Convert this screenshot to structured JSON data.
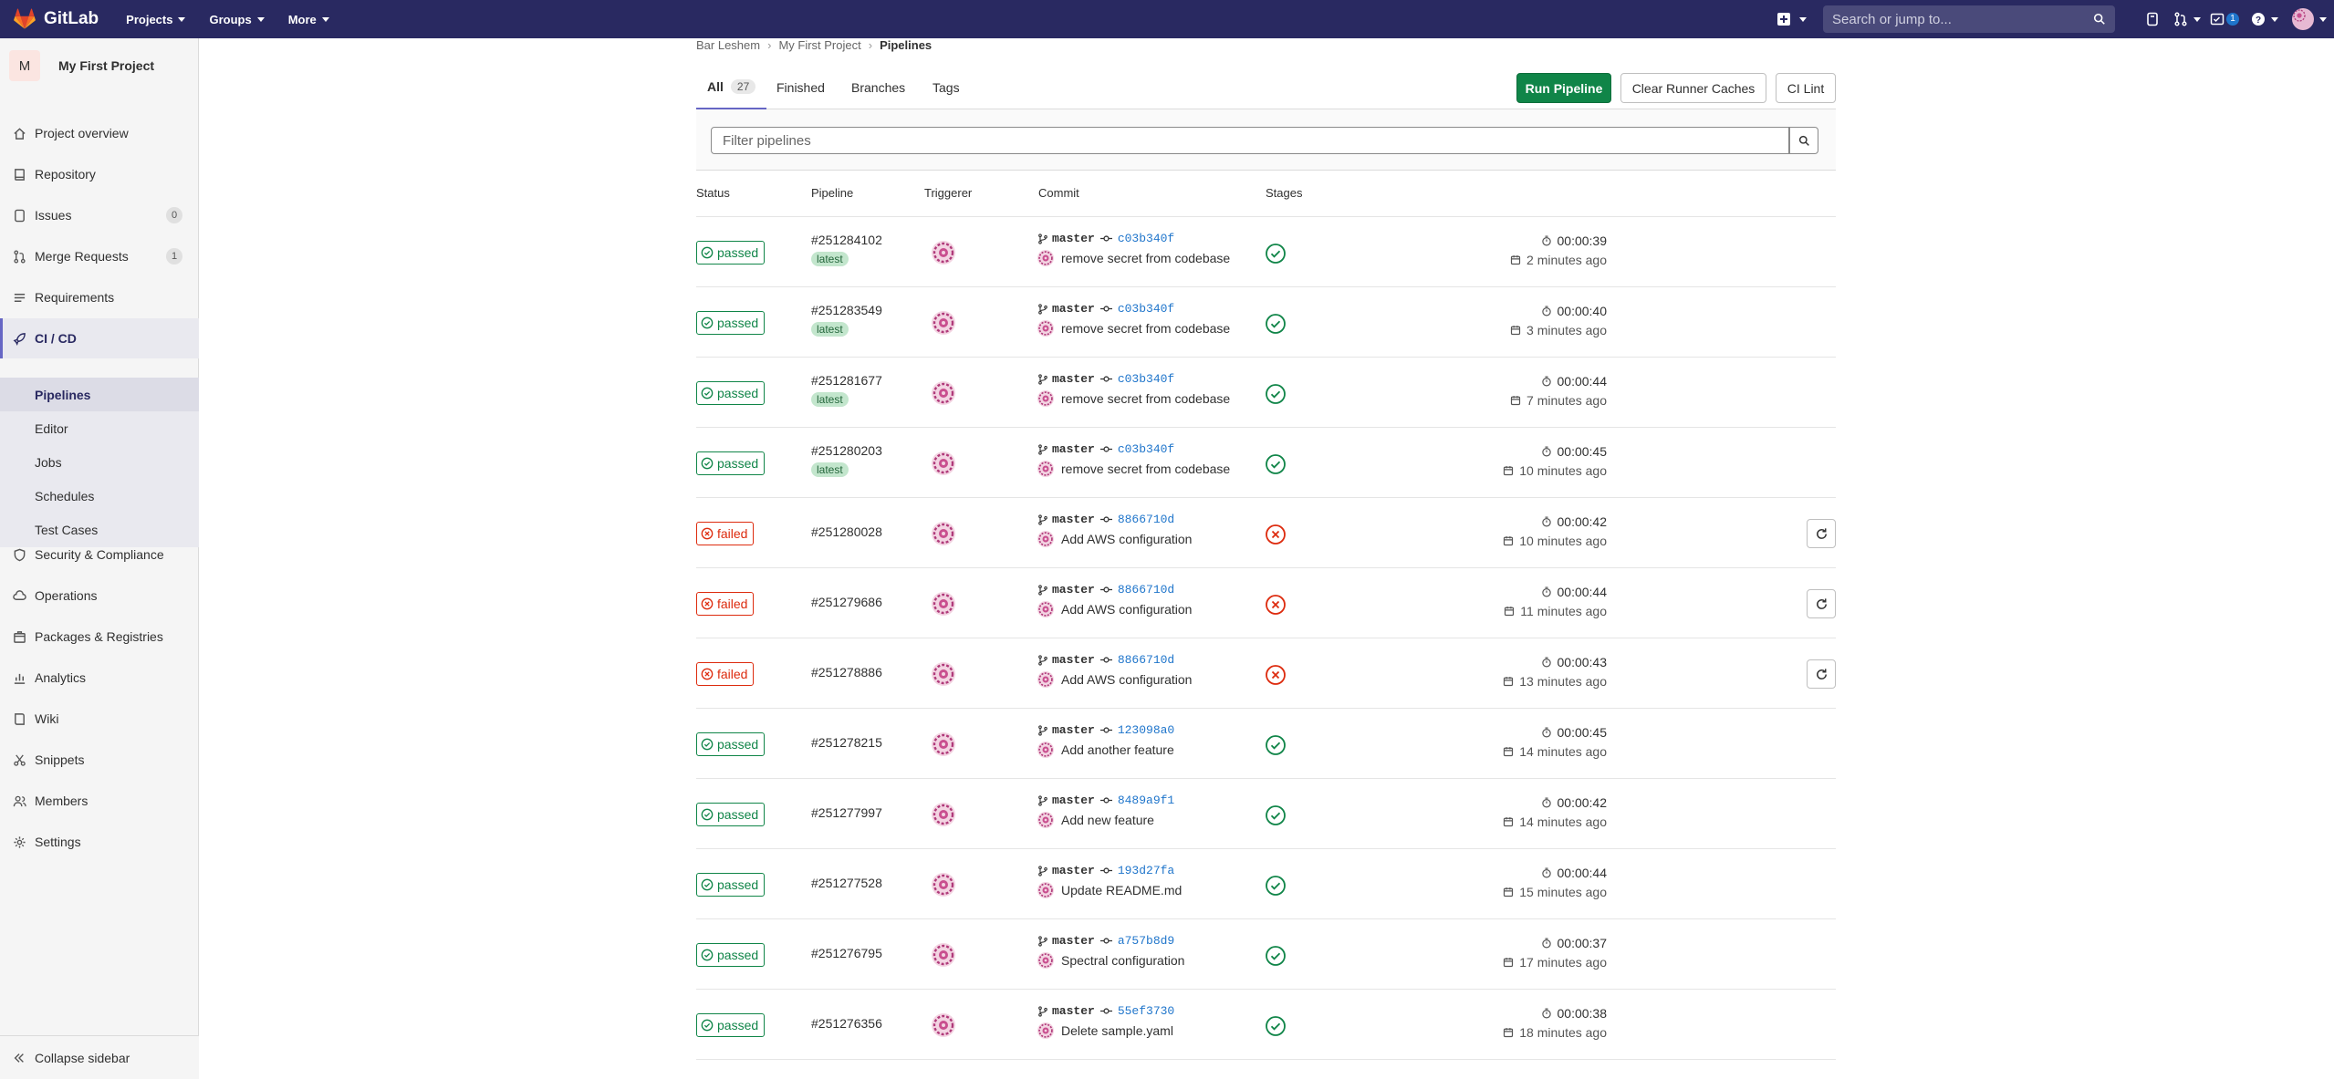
{
  "topbar": {
    "brand": "GitLab",
    "menus": [
      "Projects",
      "Groups",
      "More"
    ],
    "search_placeholder": "Search or jump to...",
    "todo_count": "1"
  },
  "sidebar": {
    "project_initial": "M",
    "project_name": "My First Project",
    "items": [
      {
        "label": "Project overview",
        "icon": "home-icon"
      },
      {
        "label": "Repository",
        "icon": "repository-icon"
      },
      {
        "label": "Issues",
        "icon": "issues-icon",
        "count": "0"
      },
      {
        "label": "Merge Requests",
        "icon": "merge-request-icon",
        "count": "1"
      },
      {
        "label": "Requirements",
        "icon": "requirements-icon"
      },
      {
        "label": "CI / CD",
        "icon": "rocket-icon"
      },
      {
        "label": "Security & Compliance",
        "icon": "shield-icon"
      },
      {
        "label": "Operations",
        "icon": "cloud-gear-icon"
      },
      {
        "label": "Packages & Registries",
        "icon": "package-icon"
      },
      {
        "label": "Analytics",
        "icon": "chart-icon"
      },
      {
        "label": "Wiki",
        "icon": "book-icon"
      },
      {
        "label": "Snippets",
        "icon": "snippet-icon"
      },
      {
        "label": "Members",
        "icon": "users-icon"
      },
      {
        "label": "Settings",
        "icon": "gear-icon"
      }
    ],
    "cicd_sub": [
      "Pipelines",
      "Editor",
      "Jobs",
      "Schedules",
      "Test Cases"
    ],
    "collapse_label": "Collapse sidebar"
  },
  "breadcrumb": [
    "Bar Leshem",
    "My First Project",
    "Pipelines"
  ],
  "tabs": [
    {
      "label": "All",
      "count": "27"
    },
    {
      "label": "Finished"
    },
    {
      "label": "Branches"
    },
    {
      "label": "Tags"
    }
  ],
  "buttons": {
    "run_pipeline": "Run Pipeline",
    "clear_caches": "Clear Runner Caches",
    "ci_lint": "CI Lint"
  },
  "filter_placeholder": "Filter pipelines",
  "columns": [
    "Status",
    "Pipeline",
    "Triggerer",
    "Commit",
    "Stages"
  ],
  "colors": {
    "navbar": "#292961",
    "passed": "#108548",
    "failed": "#dd2b0e",
    "link": "#1f75cb"
  },
  "pipelines": [
    {
      "status": "passed",
      "id": "#251284102",
      "latest": "latest",
      "branch": "master",
      "sha": "c03b340f",
      "message": "remove secret from codebase",
      "duration": "00:00:39",
      "ago": "2 minutes ago"
    },
    {
      "status": "passed",
      "id": "#251283549",
      "latest": "latest",
      "branch": "master",
      "sha": "c03b340f",
      "message": "remove secret from codebase",
      "duration": "00:00:40",
      "ago": "3 minutes ago"
    },
    {
      "status": "passed",
      "id": "#251281677",
      "latest": "latest",
      "branch": "master",
      "sha": "c03b340f",
      "message": "remove secret from codebase",
      "duration": "00:00:44",
      "ago": "7 minutes ago"
    },
    {
      "status": "passed",
      "id": "#251280203",
      "latest": "latest",
      "branch": "master",
      "sha": "c03b340f",
      "message": "remove secret from codebase",
      "duration": "00:00:45",
      "ago": "10 minutes ago"
    },
    {
      "status": "failed",
      "id": "#251280028",
      "branch": "master",
      "sha": "8866710d",
      "message": "Add AWS configuration",
      "duration": "00:00:42",
      "ago": "10 minutes ago"
    },
    {
      "status": "failed",
      "id": "#251279686",
      "branch": "master",
      "sha": "8866710d",
      "message": "Add AWS configuration",
      "duration": "00:00:44",
      "ago": "11 minutes ago"
    },
    {
      "status": "failed",
      "id": "#251278886",
      "branch": "master",
      "sha": "8866710d",
      "message": "Add AWS configuration",
      "duration": "00:00:43",
      "ago": "13 minutes ago"
    },
    {
      "status": "passed",
      "id": "#251278215",
      "branch": "master",
      "sha": "123098a0",
      "message": "Add another feature",
      "duration": "00:00:45",
      "ago": "14 minutes ago"
    },
    {
      "status": "passed",
      "id": "#251277997",
      "branch": "master",
      "sha": "8489a9f1",
      "message": "Add new feature",
      "duration": "00:00:42",
      "ago": "14 minutes ago"
    },
    {
      "status": "passed",
      "id": "#251277528",
      "branch": "master",
      "sha": "193d27fa",
      "message": "Update README.md",
      "duration": "00:00:44",
      "ago": "15 minutes ago"
    },
    {
      "status": "passed",
      "id": "#251276795",
      "branch": "master",
      "sha": "a757b8d9",
      "message": "Spectral configuration",
      "duration": "00:00:37",
      "ago": "17 minutes ago"
    },
    {
      "status": "passed",
      "id": "#251276356",
      "branch": "master",
      "sha": "55ef3730",
      "message": "Delete sample.yaml",
      "duration": "00:00:38",
      "ago": "18 minutes ago"
    }
  ]
}
